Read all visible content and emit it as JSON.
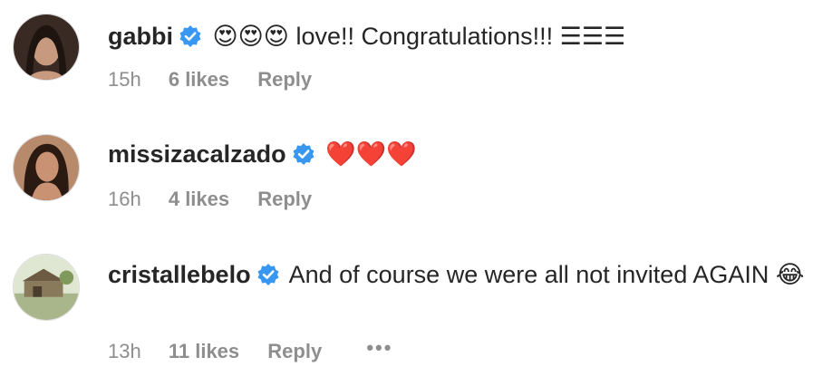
{
  "comments": [
    {
      "username": "gabbi",
      "text": "😍😍😍 love!! Congratulations!!! ☰☰☰",
      "time": "15h",
      "likes": "6 likes",
      "reply": "Reply"
    },
    {
      "username": "missizacalzado",
      "text": "❤️❤️❤️",
      "time": "16h",
      "likes": "4 likes",
      "reply": "Reply"
    },
    {
      "username": "cristallebelo",
      "text": "And of course we were all not invited AGAIN 😂",
      "time": "13h",
      "likes": "11 likes",
      "reply": "Reply",
      "more": "•••"
    }
  ],
  "icons": {
    "verified": "verified-badge-icon",
    "more": "more-options-icon"
  },
  "colors": {
    "verified_blue": "#3897f0",
    "meta_gray": "#8e8e8e",
    "text": "#262626"
  }
}
